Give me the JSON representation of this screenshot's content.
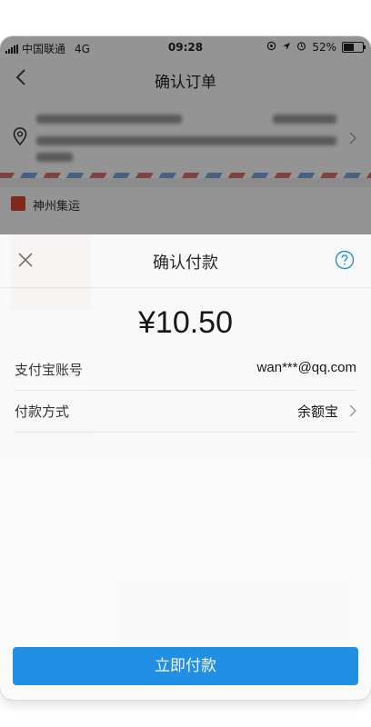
{
  "status_bar": {
    "carrier": "中国联通",
    "network": "4G",
    "time": "09:28",
    "battery": "52%",
    "battery_level": 0.52
  },
  "background": {
    "nav_title": "确认订单",
    "store_name": "神州集运"
  },
  "payment_sheet": {
    "title": "确认付款",
    "amount": "¥10.50",
    "account_label": "支付宝账号",
    "account_value": "wan***@qq.com",
    "method_label": "付款方式",
    "method_value": "余额宝",
    "pay_button": "立即付款"
  },
  "colors": {
    "accent": "#1b8fe8",
    "help_icon": "#1b8fe8",
    "store_badge": "#d6492f"
  }
}
